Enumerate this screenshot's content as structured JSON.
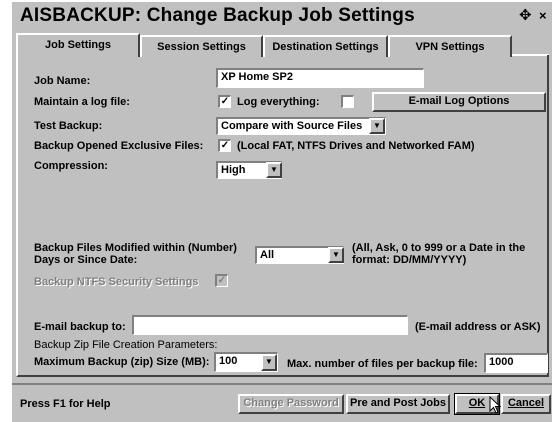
{
  "window": {
    "title": "AISBACKUP: Change Backup Job Settings",
    "move_icon": "move-icon",
    "close_label": "×"
  },
  "tabs": [
    {
      "label": "Job Settings",
      "active": true
    },
    {
      "label": "Session Settings",
      "active": false
    },
    {
      "label": "Destination Settings",
      "active": false
    },
    {
      "label": "VPN Settings",
      "active": false
    }
  ],
  "job": {
    "name_label": "Job Name:",
    "name_value": "XP Home SP2",
    "log_label": "Maintain a log file:",
    "log_checked": true,
    "log_everything_label": "Log everything:",
    "log_everything_checked": false,
    "email_log_button": "E-mail Log Options",
    "test_label": "Test Backup:",
    "test_value": "Compare with Source Files",
    "opened_label": "Backup Opened Exclusive Files:",
    "opened_checked": true,
    "opened_note": "(Local FAT, NTFS Drives and Networked FAM)",
    "compression_label": "Compression:",
    "compression_value": "High",
    "modified_label_line1": "Backup Files Modified within (Number)",
    "modified_label_line2": "Days or Since Date:",
    "modified_value": "All",
    "modified_hint_line1": "(All, Ask, 0 to 999 or a Date in the",
    "modified_hint_line2": "format: DD/MM/YYYY)",
    "ntfs_label": "Backup NTFS Security Settings",
    "ntfs_checked": true,
    "email_backup_label": "E-mail backup to:",
    "email_backup_value": "",
    "email_backup_hint": "(E-mail address or ASK)",
    "zip_header": "Backup Zip File Creation Parameters:",
    "zip_max_label": "Maximum Backup (zip) Size (MB):",
    "zip_max_value": "100",
    "max_files_label": "Max. number of files per backup file:",
    "max_files_value": "1000"
  },
  "footer": {
    "help_text": "Press F1 for Help",
    "change_password": "Change Password",
    "pre_post": "Pre and Post Jobs",
    "ok": "OK",
    "cancel": "Cancel"
  },
  "colors": {
    "face": "#c0c0c0",
    "highlight": "#ffffff",
    "shadow": "#404040"
  }
}
